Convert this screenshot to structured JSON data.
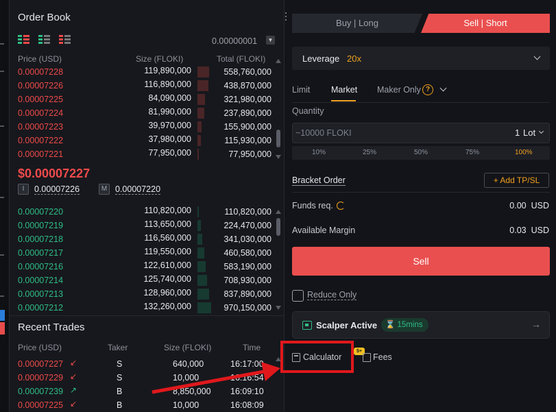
{
  "order_book": {
    "title": "Order Book",
    "precision": "0.00000001",
    "columns": {
      "price": "Price (USD)",
      "size": "Size (FLOKI)",
      "total": "Total (FLOKI)"
    },
    "asks": [
      {
        "price": "0.00007228",
        "size": "119,890,000",
        "total": "558,760,000",
        "depth": 0.21
      },
      {
        "price": "0.00007226",
        "size": "116,890,000",
        "total": "438,870,000",
        "depth": 0.2
      },
      {
        "price": "0.00007225",
        "size": "84,090,000",
        "total": "321,980,000",
        "depth": 0.14
      },
      {
        "price": "0.00007224",
        "size": "81,990,000",
        "total": "237,890,000",
        "depth": 0.13
      },
      {
        "price": "0.00007223",
        "size": "39,970,000",
        "total": "155,900,000",
        "depth": 0.07
      },
      {
        "price": "0.00007222",
        "size": "37,980,000",
        "total": "115,930,000",
        "depth": 0.06
      },
      {
        "price": "0.00007221",
        "size": "77,950,000",
        "total": "77,950,000",
        "depth": 0.03
      }
    ],
    "last_price": "$0.00007227",
    "index_tag": "I",
    "index_price": "0.00007226",
    "mark_tag": "M",
    "mark_price": "0.00007220",
    "bids": [
      {
        "price": "0.00007220",
        "size": "110,820,000",
        "total": "110,820,000",
        "depth": 0.03
      },
      {
        "price": "0.00007219",
        "size": "113,650,000",
        "total": "224,470,000",
        "depth": 0.06
      },
      {
        "price": "0.00007218",
        "size": "116,560,000",
        "total": "341,030,000",
        "depth": 0.09
      },
      {
        "price": "0.00007217",
        "size": "119,550,000",
        "total": "460,580,000",
        "depth": 0.12
      },
      {
        "price": "0.00007216",
        "size": "122,610,000",
        "total": "583,190,000",
        "depth": 0.15
      },
      {
        "price": "0.00007214",
        "size": "125,740,000",
        "total": "708,930,000",
        "depth": 0.18
      },
      {
        "price": "0.00007213",
        "size": "128,960,000",
        "total": "837,890,000",
        "depth": 0.21
      },
      {
        "price": "0.00007212",
        "size": "132,260,000",
        "total": "970,150,000",
        "depth": 0.25
      }
    ]
  },
  "recent_trades": {
    "title": "Recent Trades",
    "columns": {
      "price": "Price (USD)",
      "taker": "Taker",
      "size": "Size (FLOKI)",
      "time": "Time"
    },
    "rows": [
      {
        "price": "0.00007227",
        "side": "sell",
        "arrow": "↙",
        "taker": "S",
        "size": "640,000",
        "time": "16:17:00"
      },
      {
        "price": "0.00007229",
        "side": "sell",
        "arrow": "↙",
        "taker": "S",
        "size": "10,000",
        "time": "16:16:54"
      },
      {
        "price": "0.00007239",
        "side": "buy",
        "arrow": "↗",
        "taker": "B",
        "size": "8,850,000",
        "time": "16:09:10"
      },
      {
        "price": "0.00007225",
        "side": "sell",
        "arrow": "↙",
        "taker": "B",
        "size": "10,000",
        "time": "16:08:09"
      }
    ]
  },
  "trade_panel": {
    "tab_buy": "Buy | Long",
    "tab_sell": "Sell | Short",
    "leverage_label": "Leverage",
    "leverage_value": "20x",
    "order_types": {
      "limit": "Limit",
      "market": "Market",
      "maker_only": "Maker Only"
    },
    "help_icon": "?",
    "quantity_label": "Quantity",
    "quantity_placeholder": "~10000 FLOKI",
    "quantity_value": "1",
    "quantity_unit": "Lot",
    "percentages": [
      "10%",
      "25%",
      "50%",
      "75%",
      "100%"
    ],
    "selected_percent": "100%",
    "bracket_label": "Bracket Order",
    "add_tp_sl": "+ Add TP/SL",
    "funds_label": "Funds req.",
    "funds_value": "0.00",
    "funds_unit": "USD",
    "margin_label": "Available Margin",
    "margin_value": "0.03",
    "margin_unit": "USD",
    "sell_button": "Sell",
    "reduce_only": "Reduce Only",
    "scalper_label": "Scalper Active",
    "scalper_duration": "15mins",
    "calculator": "Calculator",
    "fees": "Fees",
    "fees_badge": "$+"
  },
  "colors": {
    "ask": "#ee4a4a",
    "bid": "#2ebd85",
    "accent": "#f0a020",
    "sell": "#ea4f4f",
    "highlight": "#e0181c"
  }
}
